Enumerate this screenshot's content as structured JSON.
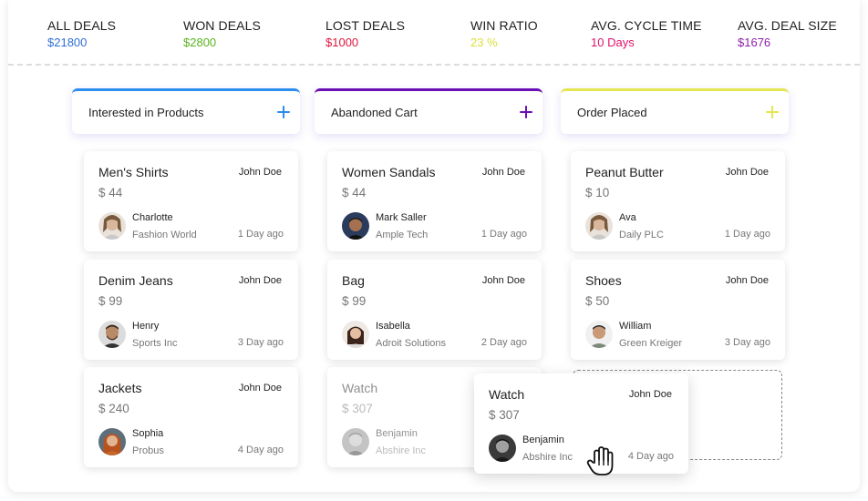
{
  "stats": [
    {
      "label": "ALL DEALS",
      "value": "$21800",
      "color": "#2f6fd6"
    },
    {
      "label": "WON DEALS",
      "value": "$2800",
      "color": "#58b31e"
    },
    {
      "label": "LOST DEALS",
      "value": "$1000",
      "color": "#e2163c"
    },
    {
      "label": "WIN RATIO",
      "value": "23 %",
      "color": "#d9df38"
    },
    {
      "label": "AVG. CYCLE TIME",
      "value": "10 Days",
      "color": "#e0126b"
    },
    {
      "label": "AVG. DEAL SIZE",
      "value": "$1676",
      "color": "#8e1fa8"
    }
  ],
  "columns": [
    {
      "title": "Interested in Products",
      "accent": "#2d8ef0",
      "cards": [
        {
          "product": "Men's Shirts",
          "owner": "John Doe",
          "price": "$ 44",
          "person": "Charlotte",
          "company": "Fashion World",
          "ago": "1 Day ago"
        },
        {
          "product": "Denim Jeans",
          "owner": "John Doe",
          "price": "$ 99",
          "person": "Henry",
          "company": "Sports Inc",
          "ago": "3 Day ago"
        },
        {
          "product": "Jackets",
          "owner": "John Doe",
          "price": "$ 240",
          "person": "Sophia",
          "company": "Probus",
          "ago": "4 Day ago"
        }
      ]
    },
    {
      "title": "Abandoned Cart",
      "accent": "#6a0fb5",
      "cards": [
        {
          "product": "Women Sandals",
          "owner": "John Doe",
          "price": "$ 44",
          "person": "Mark Saller",
          "company": "Ample Tech",
          "ago": "1 Day ago"
        },
        {
          "product": "Bag",
          "owner": "John Doe",
          "price": "$ 99",
          "person": "Isabella",
          "company": "Adroit Solutions",
          "ago": "2 Day ago"
        },
        {
          "product": "Watch",
          "owner": "John Doe",
          "price": "$ 307",
          "person": "Benjamin",
          "company": "Abshire Inc",
          "ago": ""
        }
      ]
    },
    {
      "title": "Order Placed",
      "accent": "#e4e651",
      "cards": [
        {
          "product": "Peanut Butter",
          "owner": "John Doe",
          "price": "$ 10",
          "person": "Ava",
          "company": "Daily PLC",
          "ago": "1 Day ago"
        },
        {
          "product": "Shoes",
          "owner": "John Doe",
          "price": "$ 50",
          "person": "William",
          "company": "Green Kreiger",
          "ago": "3 Day ago"
        }
      ]
    }
  ],
  "dragging_card": {
    "product": "Watch",
    "owner": "John Doe",
    "price": "$ 307",
    "person": "Benjamin",
    "company": "Abshire Inc",
    "ago": "4 Day ago"
  },
  "icons": {
    "add": "plus-icon",
    "cursor": "grab-hand-icon"
  }
}
